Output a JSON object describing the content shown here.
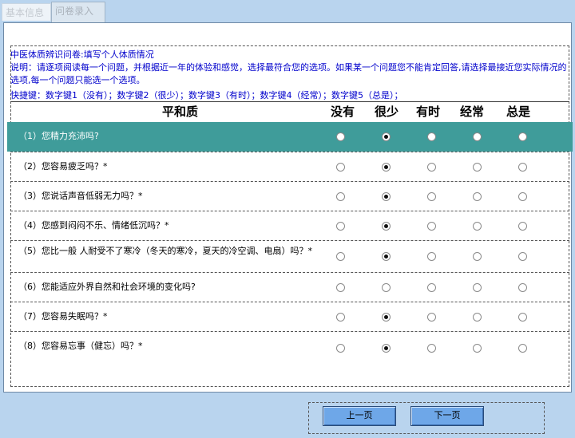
{
  "tabs": [
    {
      "label": "基本信息"
    },
    {
      "label": "问卷录入"
    }
  ],
  "questionnaire": {
    "title": "中医体质辨识问卷:填写个人体质情况",
    "description": "说明：请逐项阅读每一个问题，并根据近一年的体验和感觉，选择最符合您的选项。如果某一个问题您不能肯定回答,请选择最接近您实际情况的选项,每一个问题只能选一个选项。",
    "shortcuts": "快捷键：数字键1（没有）；数字键2（很少）；数字键3（有时）；数字键4（经常）；数字键5（总是）；",
    "section_title": "平和质",
    "options": [
      "没有",
      "很少",
      "有时",
      "经常",
      "总是"
    ],
    "questions": [
      {
        "text": "（1）您精力充沛吗?",
        "selected": 1
      },
      {
        "text": "（2）您容易疲乏吗？*",
        "selected": 1
      },
      {
        "text": "（3）您说话声音低弱无力吗？*",
        "selected": 1
      },
      {
        "text": "（4）您感到闷闷不乐、情绪低沉吗？*",
        "selected": 1
      },
      {
        "text": "（5）您比一般 人耐受不了寒冷（冬天的寒冷，夏天的冷空调、电扇）吗？*",
        "selected": 1
      },
      {
        "text": "（6）您能适应外界自然和社会环境的变化吗?",
        "selected": null
      },
      {
        "text": "（7）您容易失眠吗？*",
        "selected": 1
      },
      {
        "text": "（8）您容易忘事（健忘）吗？*",
        "selected": 1
      }
    ]
  },
  "navigation": {
    "prev_label": "上一页",
    "next_label": "下一页"
  }
}
